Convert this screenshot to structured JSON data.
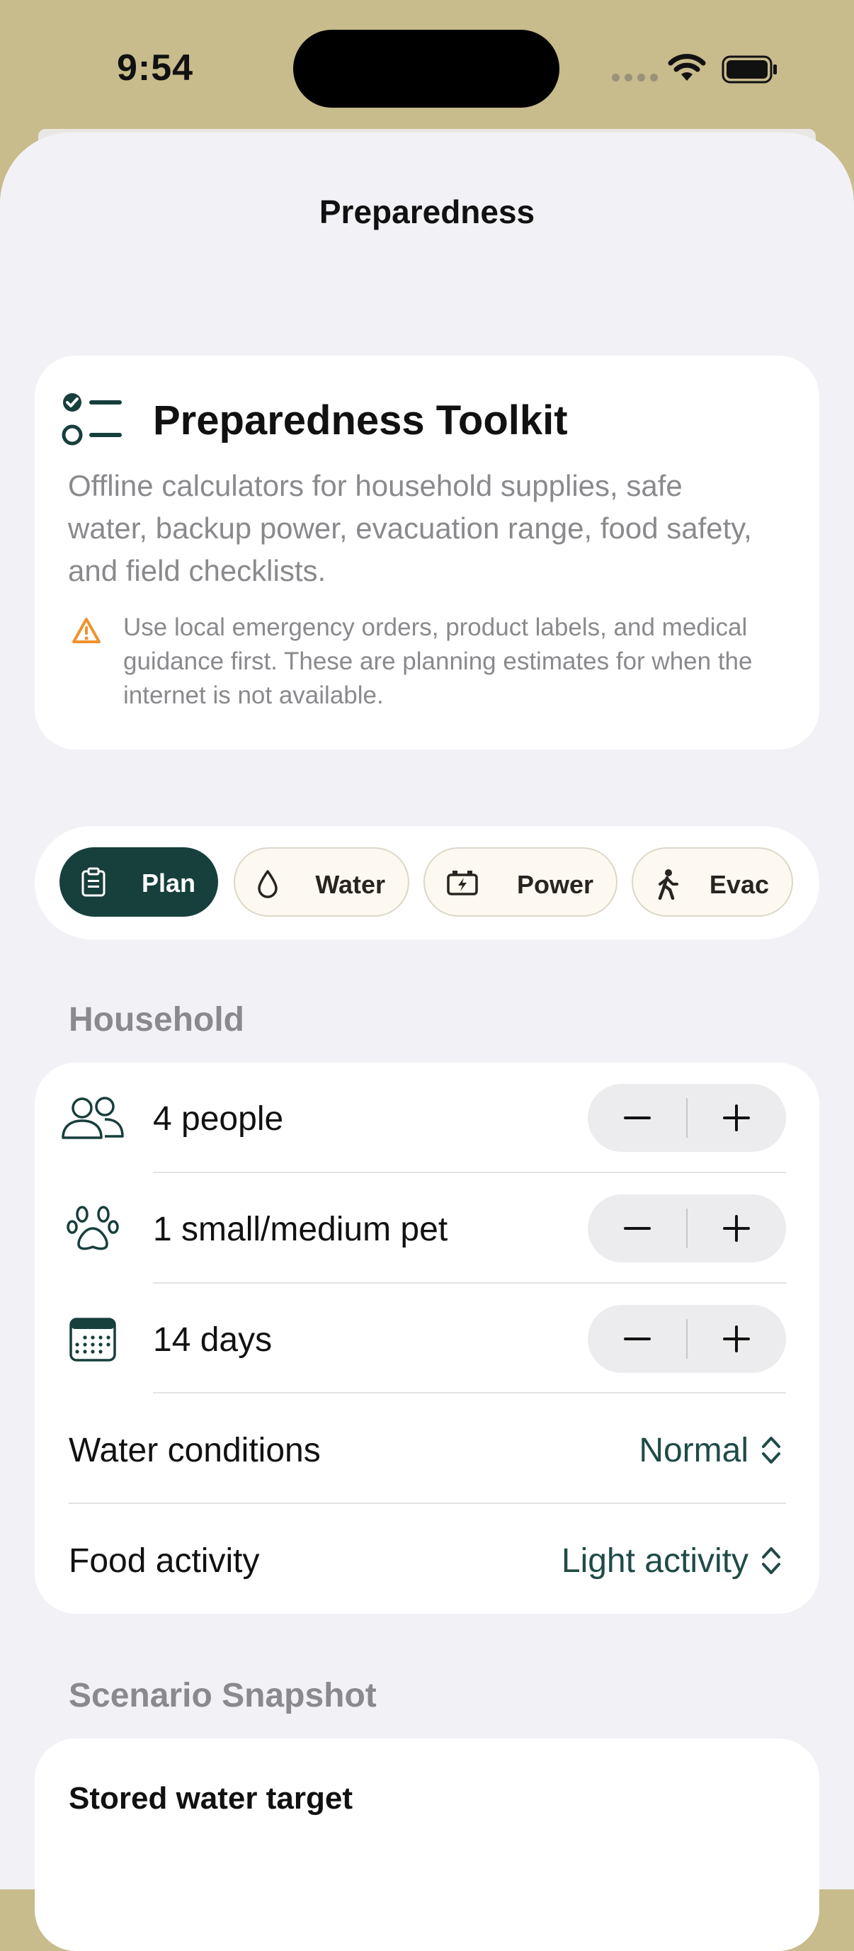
{
  "status_bar": {
    "time": "9:54"
  },
  "nav": {
    "title": "Preparedness"
  },
  "intro": {
    "title": "Preparedness Toolkit",
    "description": "Offline calculators for household supplies, safe water, backup power, evacuation range, food safety, and field checklists.",
    "warning": "Use local emergency orders, product labels, and medical guidance first. These are planning estimates for when the internet is not available."
  },
  "tabs": [
    {
      "label": "Plan",
      "icon": "clipboard-icon",
      "active": true
    },
    {
      "label": "Water",
      "icon": "drop-icon",
      "active": false
    },
    {
      "label": "Power",
      "icon": "battery-icon",
      "active": false
    },
    {
      "label": "Evac",
      "icon": "walking-icon",
      "active": false
    }
  ],
  "household": {
    "section_label": "Household",
    "rows": [
      {
        "label": "4 people",
        "icon": "people-icon"
      },
      {
        "label": "1 small/medium pet",
        "icon": "paw-icon"
      },
      {
        "label": "14 days",
        "icon": "calendar-icon"
      }
    ],
    "water_conditions": {
      "label": "Water conditions",
      "value": "Normal"
    },
    "food_activity": {
      "label": "Food activity",
      "value": "Light activity"
    }
  },
  "snapshot": {
    "section_label": "Scenario Snapshot",
    "stored_water_target": {
      "label": "Stored water target"
    }
  },
  "colors": {
    "accent": "#173f3c",
    "status_bar_bg": "#c8bb8c",
    "background": "#f2f2f6",
    "warning": "#f0922e"
  }
}
